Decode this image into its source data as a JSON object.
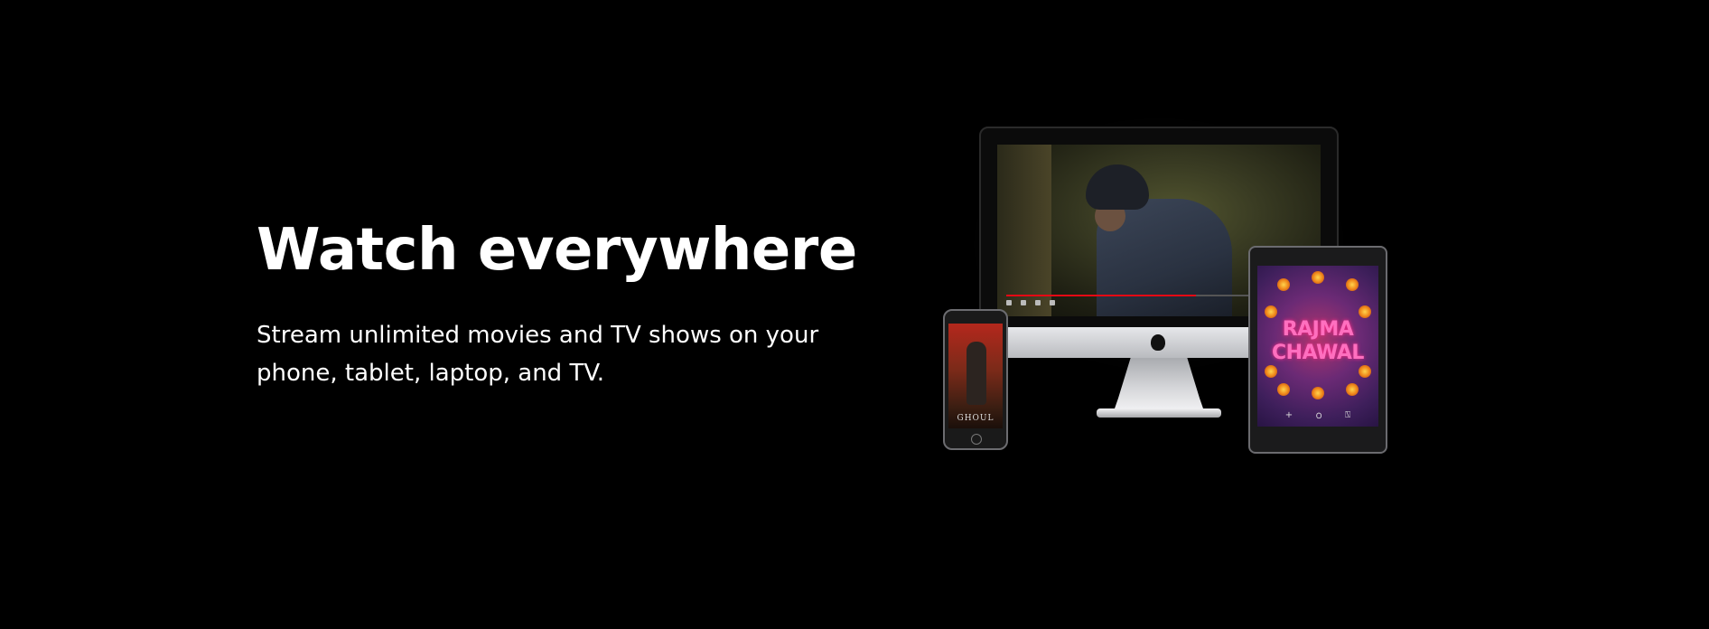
{
  "section": {
    "title": "Watch everywhere",
    "description": "Stream unlimited movies and TV shows on your phone, tablet, laptop, and TV."
  },
  "illustration": {
    "phone_title": "GHOUL",
    "tablet_title_line1": "RAJMA",
    "tablet_title_line2": "CHAWAL",
    "tablet_icons": [
      "+",
      "౦",
      "⍂"
    ],
    "icons": {
      "computer": "imac-icon",
      "apple_logo": "apple-logo-icon",
      "phone": "phone-icon",
      "tablet": "tablet-icon"
    },
    "playback_progress": 0.62
  },
  "colors": {
    "background": "#000000",
    "text": "#ffffff",
    "accent": "#e50914"
  }
}
